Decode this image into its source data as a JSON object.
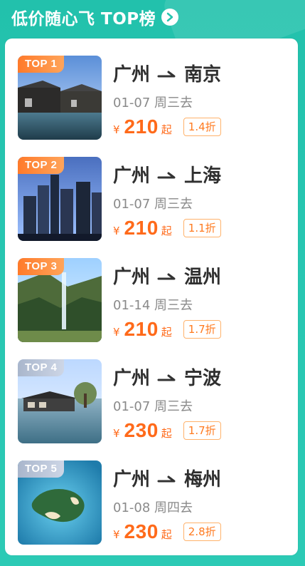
{
  "header": {
    "title": "低价随心飞 TOP榜"
  },
  "items": [
    {
      "rank": "TOP 1",
      "from": "广州",
      "to": "南京",
      "date": "01-07 周三去",
      "price": "210",
      "currency": "¥",
      "qi": "起",
      "discount": "1.4折",
      "badge_style": "hot"
    },
    {
      "rank": "TOP 2",
      "from": "广州",
      "to": "上海",
      "date": "01-07 周三去",
      "price": "210",
      "currency": "¥",
      "qi": "起",
      "discount": "1.1折",
      "badge_style": "hot"
    },
    {
      "rank": "TOP 3",
      "from": "广州",
      "to": "温州",
      "date": "01-14 周三去",
      "price": "210",
      "currency": "¥",
      "qi": "起",
      "discount": "1.7折",
      "badge_style": "hot"
    },
    {
      "rank": "TOP 4",
      "from": "广州",
      "to": "宁波",
      "date": "01-07 周三去",
      "price": "230",
      "currency": "¥",
      "qi": "起",
      "discount": "1.7折",
      "badge_style": "cold"
    },
    {
      "rank": "TOP 5",
      "from": "广州",
      "to": "梅州",
      "date": "01-08 周四去",
      "price": "230",
      "currency": "¥",
      "qi": "起",
      "discount": "2.8折",
      "badge_style": "cold"
    }
  ],
  "colors": {
    "teal_bg": "#22c1ac",
    "price_orange": "#ff6a1a",
    "discount_border": "#ffb26b",
    "badge_hot": "#ff7a2a",
    "badge_cold": "#a9b6cc"
  }
}
